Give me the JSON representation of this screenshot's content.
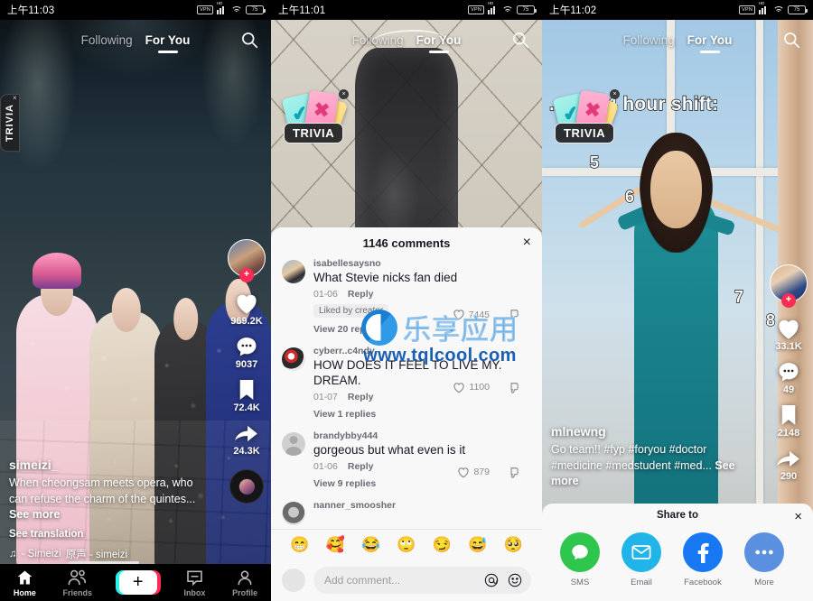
{
  "panels": [
    {
      "status": {
        "time": "上午11:03",
        "vpn": "VPN",
        "hd": "HD",
        "battery": "75"
      },
      "topnav": {
        "following": "Following",
        "for_you": "For You",
        "search_icon": "search-icon"
      },
      "trivia": {
        "label": "TRIVIA",
        "close": "×"
      },
      "video": {
        "username": "simeizi_",
        "caption": "When cheongsam meets opera, who can refuse the charm of the quintes...",
        "see_more": "See more",
        "see_translation": "See translation",
        "music_note": "♫",
        "music": "- Simeizi",
        "music_cn": "原声 - simeizi"
      },
      "actions": {
        "likes": "969.2K",
        "comments": "9037",
        "bookmarks": "72.4K",
        "shares": "24.3K",
        "follow_plus": "+"
      },
      "bottomnav": [
        {
          "label": "Home",
          "icon": "home-icon",
          "active": true
        },
        {
          "label": "Friends",
          "icon": "friends-icon",
          "active": false
        },
        {
          "label": "",
          "icon": "create-plus-icon",
          "active": false
        },
        {
          "label": "Inbox",
          "icon": "inbox-icon",
          "active": false
        },
        {
          "label": "Profile",
          "icon": "profile-icon",
          "active": false
        }
      ]
    },
    {
      "status": {
        "time": "上午11:01",
        "vpn": "VPN",
        "hd": "HD",
        "battery": "75"
      },
      "topnav": {
        "following": "Following",
        "for_you": "For You",
        "search_icon": "search-icon"
      },
      "trivia": {
        "label": "TRIVIA",
        "close": "×"
      },
      "comments": {
        "title": "1146 comments",
        "close": "×",
        "items": [
          {
            "user": "isabellesaysno",
            "text": "What Stevie nicks fan died",
            "date": "01-06",
            "reply": "Reply",
            "likes": "7445",
            "tag": "Liked by creator",
            "replies": "View 20 replies"
          },
          {
            "user": "cyberr..c4ndy",
            "text": "HOW DOES IT FEEL TO LIVE MY. DREAM.",
            "date": "01-07",
            "reply": "Reply",
            "likes": "1100",
            "tag": "",
            "replies": "View 1 replies"
          },
          {
            "user": "brandybby444",
            "text": "gorgeous but what even is it",
            "date": "01-06",
            "reply": "Reply",
            "likes": "879",
            "tag": "",
            "replies": "View 9 replies"
          },
          {
            "user": "nanner_smoosher",
            "text": "",
            "date": "",
            "reply": "",
            "likes": "",
            "tag": "",
            "replies": ""
          }
        ],
        "emojis": [
          "😁",
          "🥰",
          "😂",
          "🙄",
          "😏",
          "😅",
          "🥺"
        ],
        "input_placeholder": "Add comment...",
        "mention_icon": "at-mention-icon",
        "emoji_icon": "emoji-picker-icon"
      }
    },
    {
      "status": {
        "time": "上午11:02",
        "vpn": "VPN",
        "hd": "HD",
        "battery": "75"
      },
      "topnav": {
        "following": "Following",
        "for_you": "For You",
        "search_icon": "search-icon"
      },
      "trivia": {
        "label": "TRIVIA",
        "close": "×"
      },
      "video": {
        "title": "...ter 24 hour shift:",
        "numbers": [
          "5",
          "6",
          "7",
          "8"
        ],
        "username": "mlnewng",
        "caption": "Go team!! #fyp #foryou #doctor #medicine #medstudent #med...",
        "see_more": "See more"
      },
      "actions": {
        "likes": "33.1K",
        "comments": "49",
        "bookmarks": "2148",
        "shares": "290",
        "follow_plus": "+"
      },
      "share": {
        "title": "Share to",
        "close": "×",
        "items": [
          {
            "label": "SMS",
            "icon": "sms-icon",
            "color": "#2ec64d"
          },
          {
            "label": "Email",
            "icon": "email-icon",
            "color": "#21b4e8"
          },
          {
            "label": "Facebook",
            "icon": "facebook-icon",
            "color": "#1877f2"
          },
          {
            "label": "More",
            "icon": "more-dots-icon",
            "color": "#5b8fe0"
          }
        ]
      }
    }
  ],
  "watermark": {
    "cn": "乐享应用",
    "url": "www.tqlcool.com"
  },
  "colors": {
    "accent_pink": "#fe2c55",
    "accent_cyan": "#25f4ee"
  }
}
